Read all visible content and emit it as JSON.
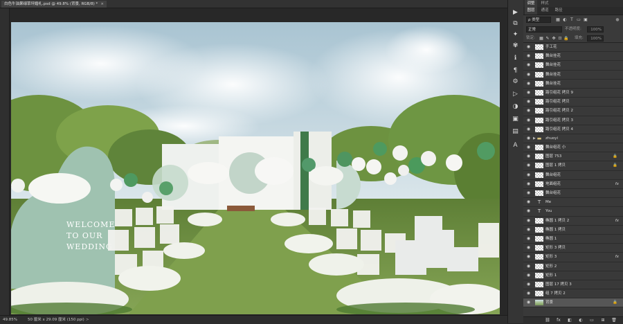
{
  "document": {
    "tab_title": "白色牛油果绿草坪婚礼.psd @ 49.8% (背景, RGB/8) *",
    "close_glyph": "×"
  },
  "artwork": {
    "welcome_lines": [
      "WELCOME",
      "TO OUR",
      "WEDDING"
    ],
    "colors": {
      "sky": "#b9cfd8",
      "lawn": "#6e8f3f",
      "aisle": "#7a9a48",
      "arch_mint": "#a9c7b7",
      "balloon_green": "#4f9a5f"
    }
  },
  "statusbar": {
    "zoom": "49.85%",
    "info": "50 厘米 x 29.09 厘米 (150 ppi)",
    "arrow": ">"
  },
  "icon_strip": {
    "icons": [
      "history-icon",
      "adjustments-icon",
      "brush-settings-icon",
      "clone-source-icon",
      "info-icon",
      "paragraph-icon",
      "properties-icon",
      "actions-icon",
      "channels-icon",
      "libraries-icon",
      "swatches-icon",
      "character-icon"
    ],
    "glyphs": [
      "▶",
      "⧉",
      "✦",
      "✾",
      "ℹ",
      "¶",
      "⚙",
      "▷",
      "◑",
      "▣",
      "▤",
      "A"
    ]
  },
  "panel": {
    "top_tabs": [
      "调整",
      "样式"
    ],
    "layer_tabs": [
      "图层",
      "通道",
      "路径"
    ],
    "filter_kind": "ρ 类型",
    "blend_mode": "正常",
    "opacity_label": "不透明度:",
    "opacity_value": "100%",
    "lock_label": "锁定:",
    "fill_label": "填充:",
    "fill_value": "100%",
    "layers": [
      {
        "name": "手工花",
        "kind": "pixel"
      },
      {
        "name": "舞台挂花",
        "kind": "pixel"
      },
      {
        "name": "舞台挂花",
        "kind": "pixel"
      },
      {
        "name": "舞台挂花",
        "kind": "pixel"
      },
      {
        "name": "舞台挂花",
        "kind": "pixel"
      },
      {
        "name": "路引组花 拷贝 9",
        "kind": "pixel"
      },
      {
        "name": "路引组花 拷贝",
        "kind": "pixel"
      },
      {
        "name": "路引组花 拷贝 2",
        "kind": "pixel"
      },
      {
        "name": "路引组花 拷贝 3",
        "kind": "pixel"
      },
      {
        "name": "路引组花 拷贝 4",
        "kind": "pixel"
      },
      {
        "name": "zhuoyi",
        "kind": "folder"
      },
      {
        "name": "舞台组花 小",
        "kind": "pixel"
      },
      {
        "name": "图层 753",
        "kind": "pixel",
        "lock": true
      },
      {
        "name": "图层 1 拷贝",
        "kind": "pixel",
        "lock": true
      },
      {
        "name": "舞台组花",
        "kind": "pixel"
      },
      {
        "name": "地面组花",
        "kind": "pixel",
        "fx": true
      },
      {
        "name": "舞台组花",
        "kind": "pixel"
      },
      {
        "name": "Me",
        "kind": "text"
      },
      {
        "name": "You",
        "kind": "text"
      },
      {
        "name": "椭圆 1 拷贝 2",
        "kind": "pixel",
        "fx": true
      },
      {
        "name": "椭圆 1 拷贝",
        "kind": "pixel"
      },
      {
        "name": "椭圆 1",
        "kind": "pixel"
      },
      {
        "name": "矩形 3 拷贝",
        "kind": "pixel"
      },
      {
        "name": "矩形 3",
        "kind": "pixel",
        "fx": true
      },
      {
        "name": "矩形 2",
        "kind": "pixel"
      },
      {
        "name": "矩形 1",
        "kind": "pixel"
      },
      {
        "name": "图层 17 拷贝 3",
        "kind": "pixel"
      },
      {
        "name": "组 7 拷贝 2",
        "kind": "pixel"
      },
      {
        "name": "背景",
        "kind": "photo",
        "lock": true,
        "selected": true
      }
    ],
    "fx_glyph": "fx",
    "lock_glyph": "🔒",
    "eye_glyph": "◉",
    "bottom_icons": [
      "link-icon",
      "fx-icon",
      "mask-icon",
      "adjustment-layer-icon",
      "group-icon",
      "new-layer-icon",
      "delete-icon"
    ],
    "bottom_glyphs": [
      "⛓",
      "fx",
      "◧",
      "◐",
      "▭",
      "⊞",
      "🗑"
    ]
  }
}
